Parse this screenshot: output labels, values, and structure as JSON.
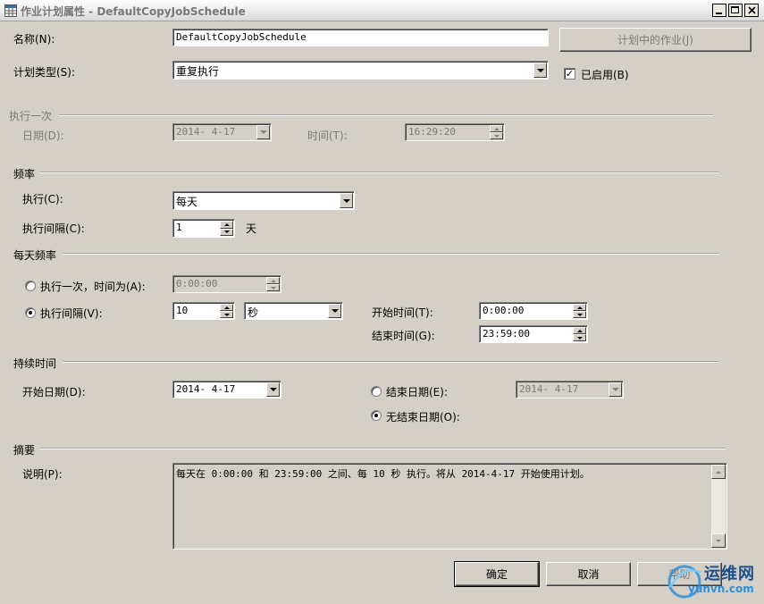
{
  "window": {
    "title": "作业计划属性 - DefaultCopyJobSchedule",
    "controls": [
      "minimize",
      "maximize",
      "close"
    ]
  },
  "general": {
    "name_label": "名称(N):",
    "name_value": "DefaultCopyJobSchedule",
    "jobs_button": "计划中的作业(J)",
    "schedule_type_label": "计划类型(S):",
    "schedule_type_value": "重复执行",
    "enabled_label": "已启用(B)",
    "enabled_checked": true
  },
  "one_time": {
    "section": "执行一次",
    "date_label": "日期(D):",
    "date_value": "2014- 4-17",
    "time_label": "时间(T):",
    "time_value": "16:29:20"
  },
  "frequency": {
    "section": "频率",
    "occurs_label": "执行(C):",
    "occurs_value": "每天",
    "recurs_label": "执行间隔(C):",
    "recurs_value": "1",
    "recurs_unit": "天"
  },
  "daily_frequency": {
    "section": "每天频率",
    "once_label": "执行一次，时间为(A):",
    "once_value": "0:00:00",
    "every_label": "执行间隔(V):",
    "every_value": "10",
    "every_unit": "秒",
    "selected": "every",
    "start_label": "开始时间(T):",
    "start_value": "0:00:00",
    "end_label": "结束时间(G):",
    "end_value": "23:59:00"
  },
  "duration": {
    "section": "持续时间",
    "start_date_label": "开始日期(D):",
    "start_date_value": "2014- 4-17",
    "end_date_label": "结束日期(E):",
    "end_date_value": "2014- 4-17",
    "no_end_label": "无结束日期(O):",
    "selected": "no_end"
  },
  "summary": {
    "section": "摘要",
    "desc_label": "说明(P):",
    "desc_text": "每天在 0:00:00 和 23:59:00 之间、每 10 秒 执行。将从 2014-4-17 开始使用计划。"
  },
  "buttons": {
    "ok": "确定",
    "cancel": "取消",
    "help": "帮助"
  },
  "watermark": {
    "text": "运维网",
    "url": "yunvn.com"
  }
}
